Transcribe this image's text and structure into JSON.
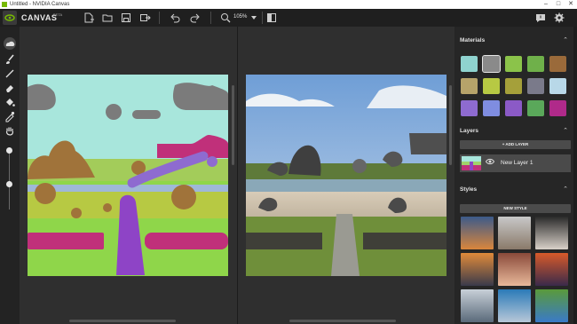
{
  "window": {
    "title": "Untitled - NVIDIA Canvas",
    "controls": [
      "–",
      "□",
      "✕"
    ]
  },
  "toolbar": {
    "brand": "CANVAS",
    "beta": "BETA",
    "zoom": "105%",
    "icons": [
      "new-file-icon",
      "open-folder-icon",
      "save-icon",
      "export-icon",
      "undo-icon",
      "redo-icon",
      "zoom-icon",
      "compare-icon",
      "feedback-icon",
      "settings-icon"
    ]
  },
  "tools": [
    "shape-brush-tool",
    "brush-tool",
    "line-tool",
    "eraser-tool",
    "fill-tool",
    "eyedropper-tool",
    "hand-tool"
  ],
  "panel": {
    "materials_title": "Materials",
    "layers_title": "Layers",
    "add_layer": "+ ADD LAYER",
    "layer_name": "New Layer 1",
    "styles_title": "Styles",
    "new_style": "NEW STYLE"
  },
  "materials": [
    {
      "name": "water-material",
      "color": "#8fd3cf"
    },
    {
      "name": "cloud-material",
      "color": "#8a8a8a"
    },
    {
      "name": "grass-material",
      "color": "#8bc34a"
    },
    {
      "name": "hill-material",
      "color": "#6fb04a"
    },
    {
      "name": "dirt-material",
      "color": "#9a6a3a"
    },
    {
      "name": "mountain-material",
      "color": "#b6a36a"
    },
    {
      "name": "tree-material",
      "color": "#b7c943"
    },
    {
      "name": "bush-material",
      "color": "#a5a03a"
    },
    {
      "name": "snow-material",
      "color": "#7a7a8a"
    },
    {
      "name": "sky-material",
      "color": "#b8d8e8"
    },
    {
      "name": "sea-material",
      "color": "#8e6bd0"
    },
    {
      "name": "fog-material",
      "color": "#7f8de0"
    },
    {
      "name": "flower-material",
      "color": "#8b5ac6"
    },
    {
      "name": "house-material",
      "color": "#5aa85a"
    },
    {
      "name": "road-material",
      "color": "#b02a8a"
    }
  ],
  "styles": [
    {
      "name": "style-sunset-coast",
      "colors": [
        "#3c5a8a",
        "#d9863c"
      ]
    },
    {
      "name": "style-white-cliffs",
      "colors": [
        "#c8c8c8",
        "#8a7a6a"
      ]
    },
    {
      "name": "style-cave-arch",
      "colors": [
        "#2a2a2a",
        "#d8d0c8"
      ]
    },
    {
      "name": "style-orange-sky",
      "colors": [
        "#e08a3a",
        "#3a3a4a"
      ]
    },
    {
      "name": "style-red-rock",
      "colors": [
        "#8a4a3a",
        "#e8b89a"
      ]
    },
    {
      "name": "style-dusk-lake",
      "colors": [
        "#d85a2a",
        "#3a2a4a"
      ]
    },
    {
      "name": "style-snow-peak",
      "colors": [
        "#c8d0d8",
        "#5a6a7a"
      ]
    },
    {
      "name": "style-blue-mountains",
      "colors": [
        "#2a7ab8",
        "#b8c8d8"
      ]
    },
    {
      "name": "style-green-valley",
      "colors": [
        "#5a9a3a",
        "#3a7ac8"
      ]
    }
  ]
}
